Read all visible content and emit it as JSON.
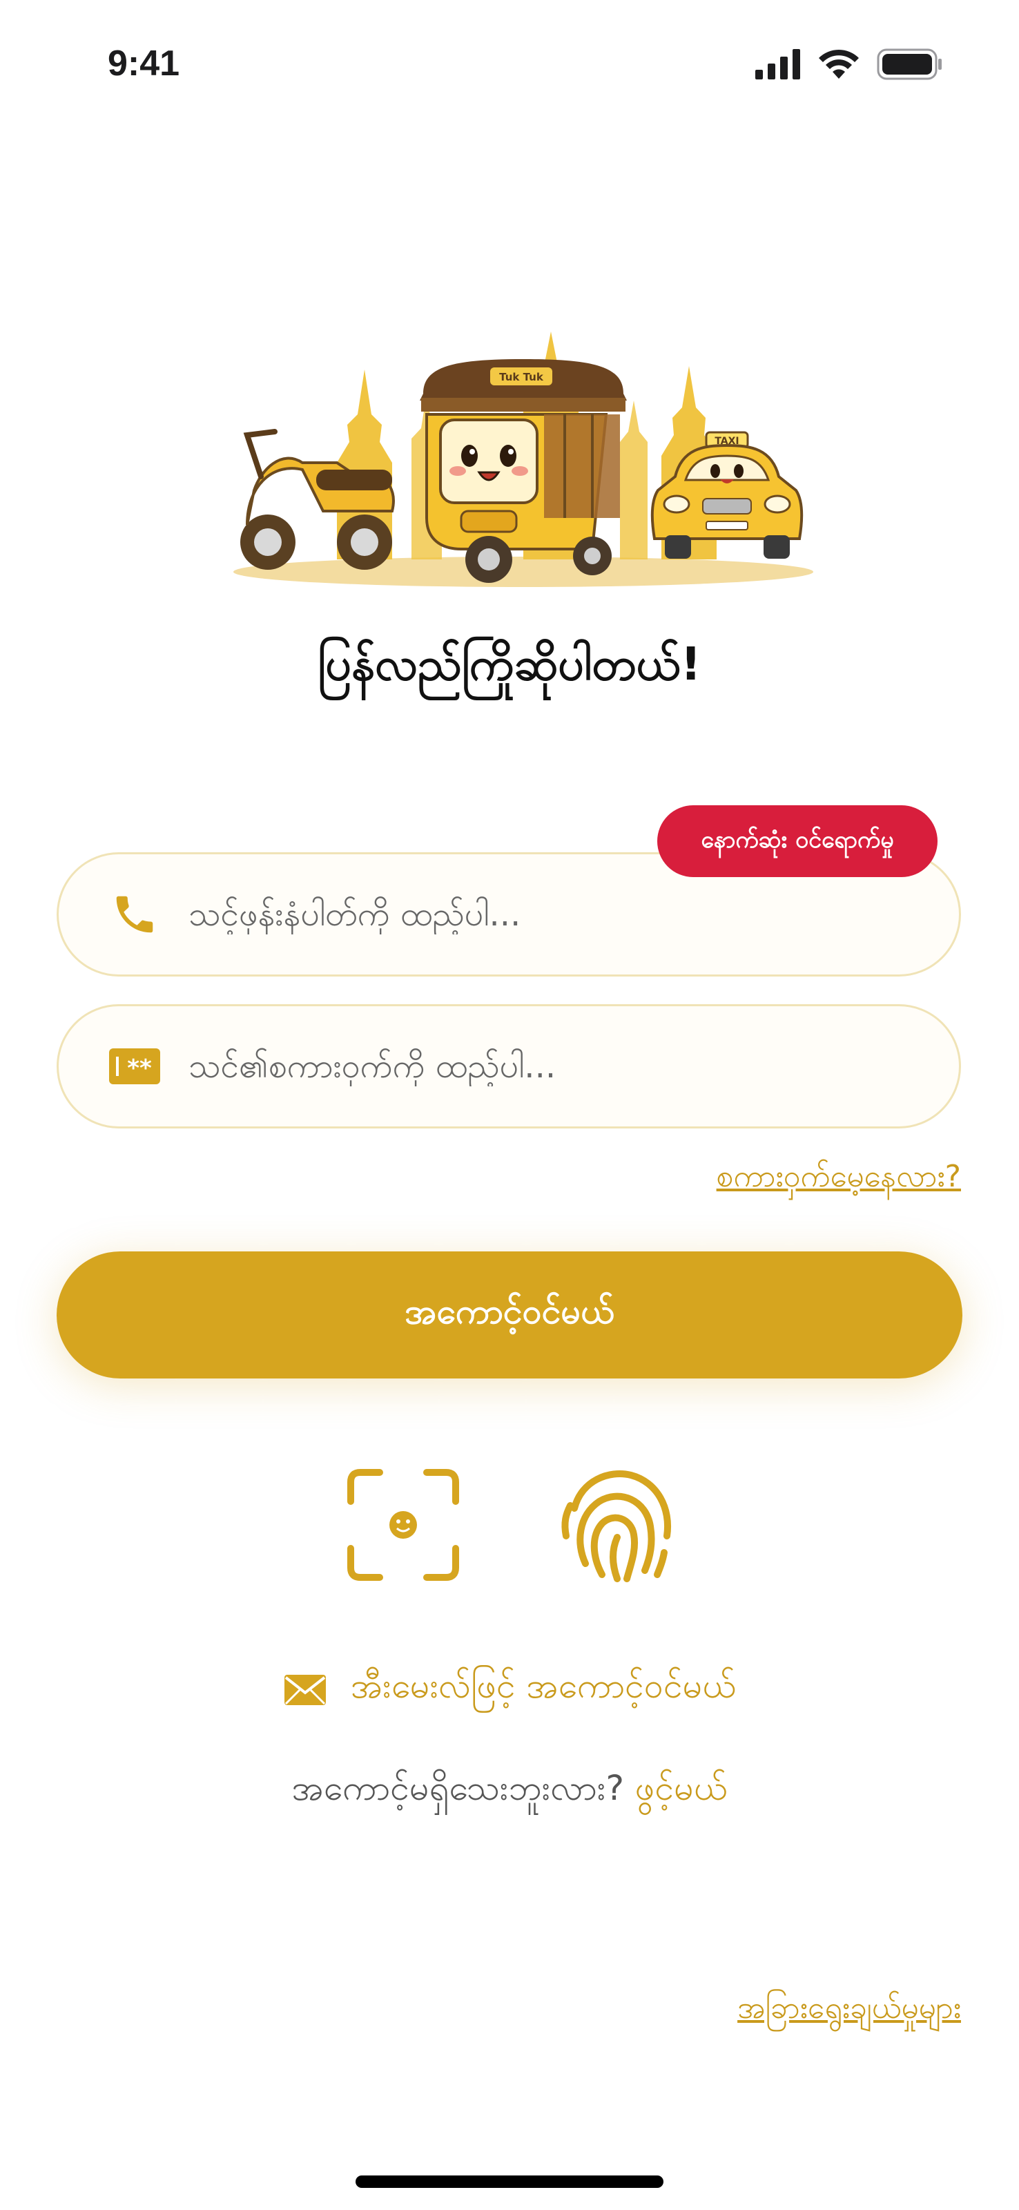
{
  "status_bar": {
    "time": "9:41"
  },
  "welcome": {
    "title": "ပြန်လည်ကြိုဆိုပါတယ်!"
  },
  "badge": {
    "recent_login": "နောက်ဆုံး ဝင်ရောက်မှု"
  },
  "fields": {
    "phone_placeholder": "သင့်ဖုန်းနံပါတ်ကို ထည့်ပါ...",
    "password_placeholder": "သင်၏စကားဝှက်ကို ထည့်ပါ..."
  },
  "links": {
    "forgot_password": "စကားဝှက်မေ့နေလား?",
    "other_options": "အခြားရွေးချယ်မှုများ"
  },
  "buttons": {
    "login": "အကောင့်ဝင်မယ်"
  },
  "email_login": {
    "label": "အီးမေးလ်ဖြင့် အကောင့်ဝင်မယ်"
  },
  "signup": {
    "prompt": "အကောင့်မရှိသေးဘူးလား?",
    "link": "ဖွင့်မယ်"
  },
  "hero": {
    "tuktuk_sign": "Tuk Tuk",
    "taxi_sign": "TAXI"
  },
  "colors": {
    "accent": "#d6a51f",
    "badge": "#d81e3c",
    "field_border": "#f0e3b6"
  }
}
